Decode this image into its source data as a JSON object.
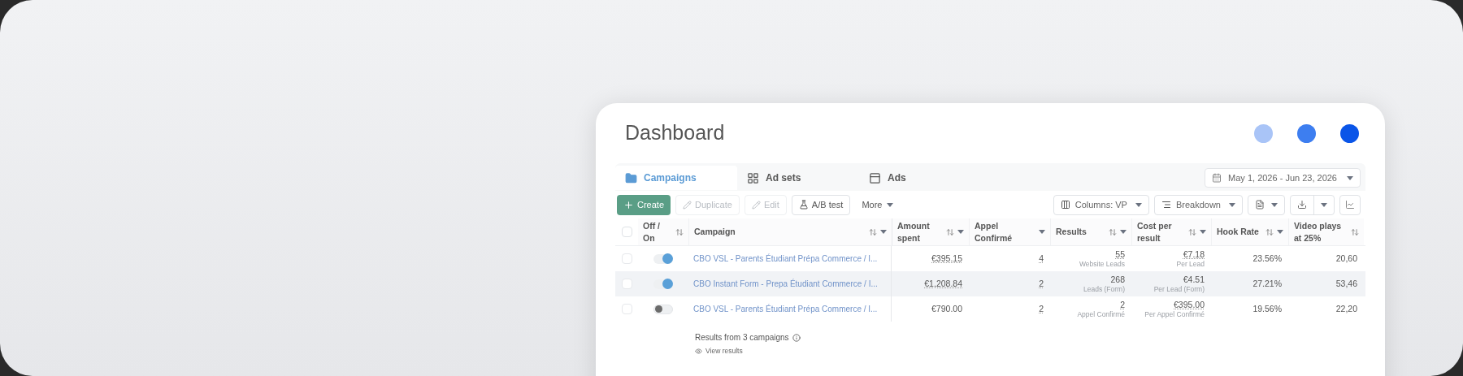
{
  "title": "Dashboard",
  "dots": [
    {
      "color": "#a9c4f7"
    },
    {
      "color": "#3d7ef0"
    },
    {
      "color": "#0a55e8"
    }
  ],
  "tabs": [
    {
      "label": "Campaigns",
      "selected": true
    },
    {
      "label": "Ad sets",
      "selected": false
    },
    {
      "label": "Ads",
      "selected": false
    }
  ],
  "date_range": "May 1, 2026 - Jun 23, 2026",
  "actions": [
    {
      "kind": "primary",
      "label": "Create"
    },
    {
      "kind": "disabled",
      "label": "Duplicate"
    },
    {
      "kind": "disabled",
      "label": "Edit"
    },
    {
      "kind": "outline",
      "label": "A/B test"
    },
    {
      "kind": "menu",
      "label": "More"
    }
  ],
  "view_controls": [
    {
      "kind": "columns",
      "label": "Columns: VP"
    },
    {
      "kind": "breakdown",
      "label": "Breakdown"
    }
  ],
  "select_all_checked": false,
  "columns": [
    {
      "label": "Off / On",
      "sortable": true,
      "menu": false
    },
    {
      "label": "Campaign",
      "sortable": true,
      "menu": true
    },
    {
      "label": "Amount spent",
      "sortable": true,
      "menu": true
    },
    {
      "label": "Appel Confirmé",
      "sortable": false,
      "menu": true
    },
    {
      "label": "Results",
      "sortable": true,
      "menu": true
    },
    {
      "label": "Cost per result",
      "sortable": true,
      "menu": true
    },
    {
      "label": "Hook Rate",
      "sortable": true,
      "menu": true
    },
    {
      "label": "Video plays at 25%",
      "sortable": true,
      "menu": false
    }
  ],
  "rows": [
    {
      "checked": false,
      "on": true,
      "highlighted": false,
      "campaign": "CBO VSL - Parents Étudiant Prépa Commerce / I...",
      "cells": [
        {
          "value": "€395.15",
          "underlined": true
        },
        {
          "value": "4",
          "underlined": true
        },
        {
          "value": "55",
          "sub": "Website Leads",
          "underlined": true
        },
        {
          "value": "€7.18",
          "sub": "Per Lead",
          "underlined": true
        },
        {
          "value": "23.56%",
          "underlined": false
        },
        {
          "value": "20,60",
          "underlined": false
        }
      ]
    },
    {
      "checked": false,
      "on": true,
      "highlighted": true,
      "campaign": "CBO Instant Form - Prepa Étudiant Commerce / I...",
      "cells": [
        {
          "value": "€1,208.84",
          "underlined": true
        },
        {
          "value": "2",
          "underlined": true
        },
        {
          "value": "268",
          "sub": "Leads (Form)",
          "underlined": false
        },
        {
          "value": "€4.51",
          "sub": "Per Lead (Form)",
          "underlined": false
        },
        {
          "value": "27.21%",
          "underlined": false
        },
        {
          "value": "53,46",
          "underlined": false
        }
      ]
    },
    {
      "checked": false,
      "on": false,
      "highlighted": false,
      "campaign": "CBO VSL - Parents Étudiant Prépa Commerce / I...",
      "cells": [
        {
          "value": "€790.00",
          "underlined": false
        },
        {
          "value": "2",
          "underlined": true
        },
        {
          "value": "2",
          "sub": "Appel Confirmé",
          "underlined": true
        },
        {
          "value": "€395.00",
          "sub": "Per Appel Confirmé",
          "underlined": true
        },
        {
          "value": "19.56%",
          "underlined": false
        },
        {
          "value": "22,20",
          "underlined": false
        }
      ]
    }
  ],
  "footer": {
    "summary": "Results from 3 campaigns",
    "link": "View results"
  }
}
